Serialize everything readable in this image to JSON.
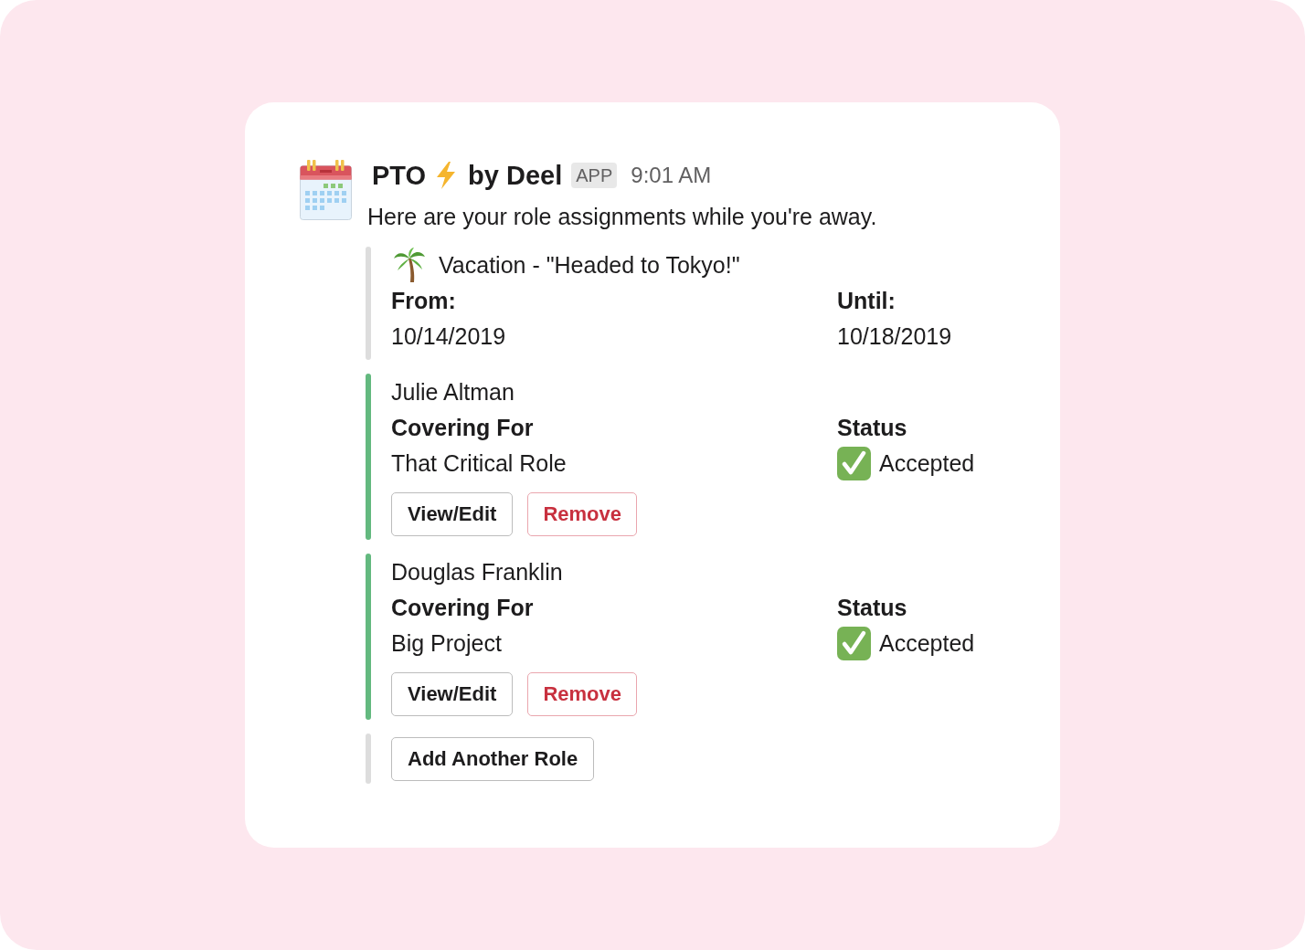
{
  "message": {
    "sender": "PTO",
    "sender_suffix": "by Deel",
    "badge": "APP",
    "time": "9:01 AM",
    "text": "Here are your role assignments while you're away."
  },
  "attachments": [
    {
      "kind": "event",
      "color": "#dddddd",
      "title": "Vacation - \"Headed to Tokyo!\"",
      "fields": [
        {
          "kind": "text",
          "label": "From:",
          "value": "10/14/2019"
        },
        {
          "kind": "text",
          "label": "Until:",
          "value": "10/18/2019"
        }
      ]
    },
    {
      "kind": "role",
      "color": "#63b97f",
      "title": "Julie Altman",
      "fields": [
        {
          "kind": "text",
          "label": "Covering For",
          "value": "That Critical Role"
        },
        {
          "kind": "status",
          "label": "Status",
          "value": "Accepted"
        }
      ],
      "buttons": [
        {
          "kind": "default",
          "label": "View/Edit"
        },
        {
          "kind": "danger",
          "label": "Remove"
        }
      ]
    },
    {
      "kind": "role",
      "color": "#63b97f",
      "title": "Douglas Franklin",
      "fields": [
        {
          "kind": "text",
          "label": "Covering For",
          "value": "Big Project"
        },
        {
          "kind": "status",
          "label": "Status",
          "value": "Accepted"
        }
      ],
      "buttons": [
        {
          "kind": "default",
          "label": "View/Edit"
        },
        {
          "kind": "danger",
          "label": "Remove"
        }
      ]
    },
    {
      "kind": "actions",
      "color": "#dddddd",
      "buttons": [
        {
          "kind": "default",
          "label": "Add Another Role"
        }
      ]
    }
  ]
}
